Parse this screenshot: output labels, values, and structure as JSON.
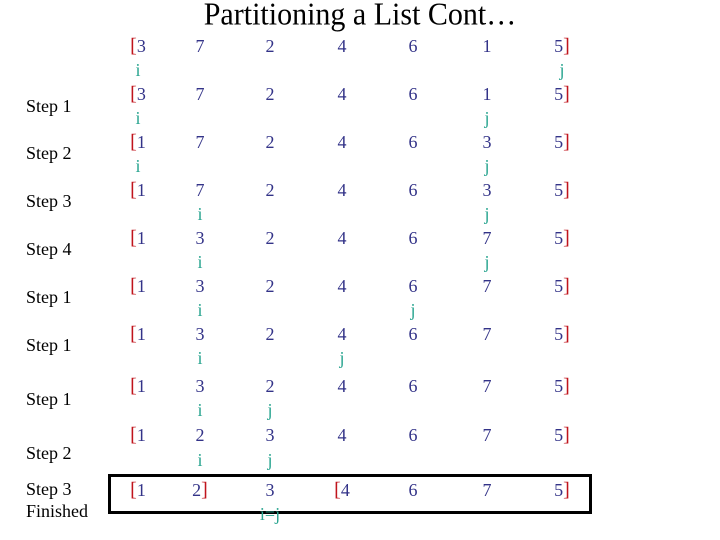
{
  "title": "Partitioning a List Cont…",
  "colors": {
    "bracket": "#c0141c",
    "number": "#333388",
    "pointer": "#2aa590",
    "text": "#000000"
  },
  "rows": [
    {
      "label": "",
      "values": [
        "3",
        "7",
        "2",
        "4",
        "6",
        "1",
        "5"
      ],
      "open": [
        0
      ],
      "close": [
        6
      ],
      "pointers": [
        {
          "col": 0,
          "text": "i"
        },
        {
          "col": 6,
          "text": "j"
        }
      ]
    },
    {
      "label": "Step 1",
      "values": [
        "3",
        "7",
        "2",
        "4",
        "6",
        "1",
        "5"
      ],
      "open": [
        0
      ],
      "close": [
        6
      ],
      "pointers": [
        {
          "col": 0,
          "text": "i"
        },
        {
          "col": 5,
          "text": "j"
        }
      ]
    },
    {
      "label": "Step 2",
      "values": [
        "1",
        "7",
        "2",
        "4",
        "6",
        "3",
        "5"
      ],
      "open": [
        0
      ],
      "close": [
        6
      ],
      "pointers": [
        {
          "col": 0,
          "text": "i"
        },
        {
          "col": 5,
          "text": "j"
        }
      ]
    },
    {
      "label": "Step 3",
      "values": [
        "1",
        "7",
        "2",
        "4",
        "6",
        "3",
        "5"
      ],
      "open": [
        0
      ],
      "close": [
        6
      ],
      "pointers": [
        {
          "col": 1,
          "text": "i"
        },
        {
          "col": 5,
          "text": "j"
        }
      ]
    },
    {
      "label": "Step 4",
      "values": [
        "1",
        "3",
        "2",
        "4",
        "6",
        "7",
        "5"
      ],
      "open": [
        0
      ],
      "close": [
        6
      ],
      "pointers": [
        {
          "col": 1,
          "text": "i"
        },
        {
          "col": 5,
          "text": "j"
        }
      ]
    },
    {
      "label": "Step 1",
      "values": [
        "1",
        "3",
        "2",
        "4",
        "6",
        "7",
        "5"
      ],
      "open": [
        0
      ],
      "close": [
        6
      ],
      "pointers": [
        {
          "col": 1,
          "text": "i"
        },
        {
          "col": 4,
          "text": "j"
        }
      ]
    },
    {
      "label": "Step 1",
      "values": [
        "1",
        "3",
        "2",
        "4",
        "6",
        "7",
        "5"
      ],
      "open": [
        0
      ],
      "close": [
        6
      ],
      "pointers": [
        {
          "col": 1,
          "text": "i"
        },
        {
          "col": 3,
          "text": "j"
        }
      ]
    },
    {
      "label": "Step 1",
      "values": [
        "1",
        "3",
        "2",
        "4",
        "6",
        "7",
        "5"
      ],
      "open": [
        0
      ],
      "close": [
        6
      ],
      "pointers": [
        {
          "col": 1,
          "text": "i"
        },
        {
          "col": 2,
          "text": "j"
        }
      ]
    },
    {
      "label": "Step 2",
      "values": [
        "1",
        "2",
        "3",
        "4",
        "6",
        "7",
        "5"
      ],
      "open": [
        0
      ],
      "close": [
        6
      ],
      "pointers": [
        {
          "col": 1,
          "text": "i"
        },
        {
          "col": 2,
          "text": "j"
        }
      ]
    },
    {
      "label": "Step 3\nFinished",
      "values": [
        "1",
        "2",
        "3",
        "4",
        "6",
        "7",
        "5"
      ],
      "open": [
        0,
        3
      ],
      "close": [
        1,
        6
      ],
      "pointers": [
        {
          "col": 2,
          "text": "i=j"
        }
      ],
      "boxed": true
    }
  ]
}
